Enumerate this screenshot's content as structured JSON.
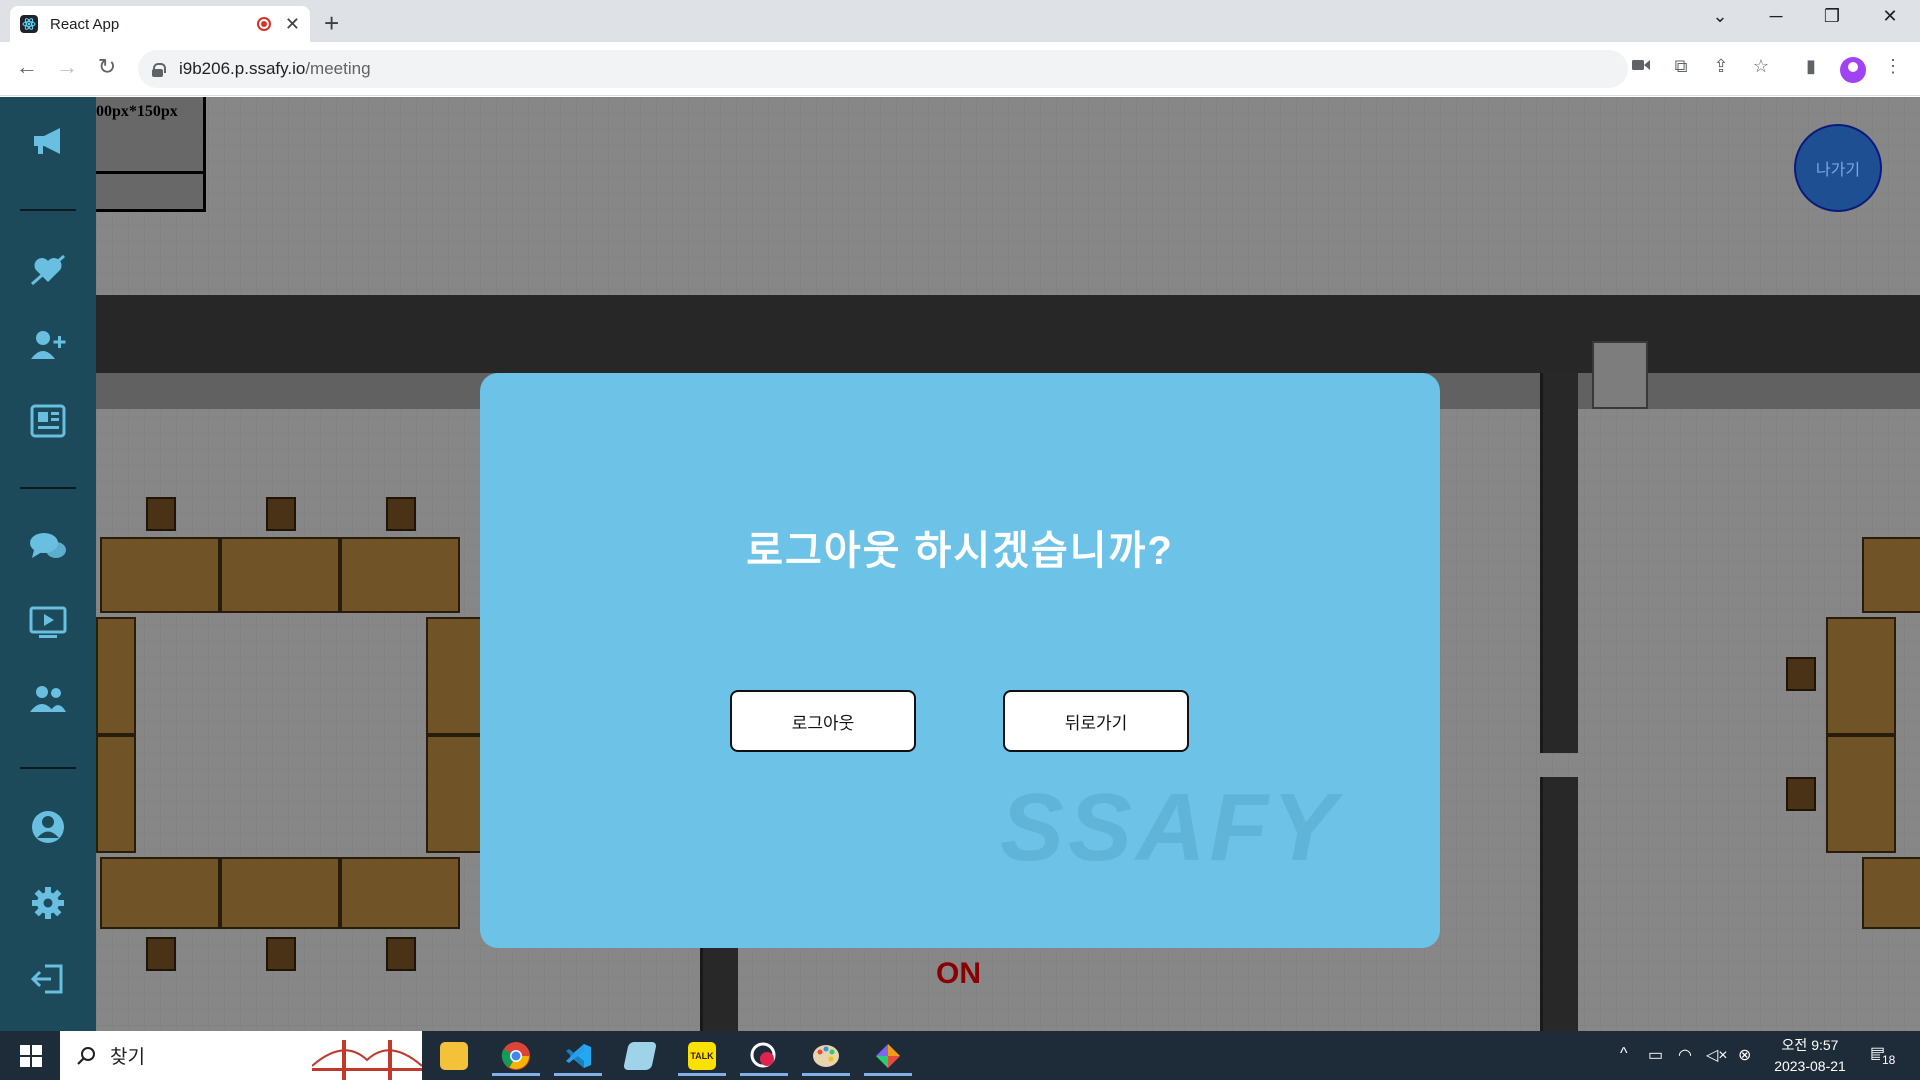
{
  "browser": {
    "tab_title": "React App",
    "url_host": "i9b206.p.ssafy.io",
    "url_path": "/meeting"
  },
  "map": {
    "frame_label": "00px*150px",
    "exit_button_label": "나가기",
    "status_label": "ON"
  },
  "modal": {
    "title": "로그아웃 하시겠습니까?",
    "logout_label": "로그아웃",
    "back_label": "뒤로가기"
  },
  "taskbar": {
    "search_placeholder": "찾기",
    "clock_period_time": "오전 9:57",
    "clock_date": "2023-08-21",
    "notification_count": "18"
  }
}
